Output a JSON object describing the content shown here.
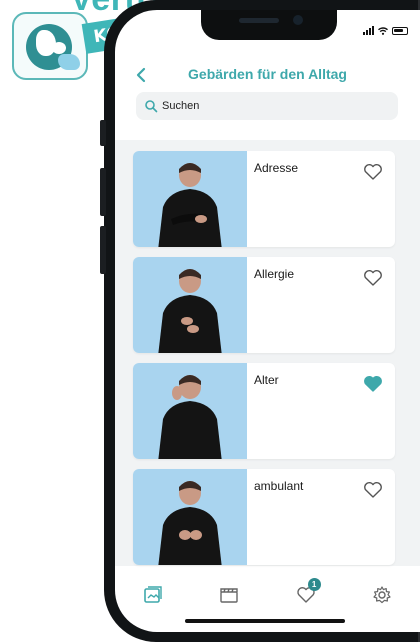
{
  "promo": {
    "headline": "Vertrauen Wörterbuch",
    "ribbon": "KOSTENLOS"
  },
  "header": {
    "title": "Gebärden für den Alltag"
  },
  "search": {
    "placeholder": "Suchen"
  },
  "signs": [
    {
      "label": "Adresse",
      "favorite": false
    },
    {
      "label": "Allergie",
      "favorite": false
    },
    {
      "label": "Alter",
      "favorite": true
    },
    {
      "label": "ambulant",
      "favorite": false
    }
  ],
  "tabbar": {
    "favorites_badge": "1"
  },
  "colors": {
    "accent": "#3ea8ab",
    "thumb_bg": "#a9d4ef",
    "list_bg": "#f1f3f4"
  }
}
